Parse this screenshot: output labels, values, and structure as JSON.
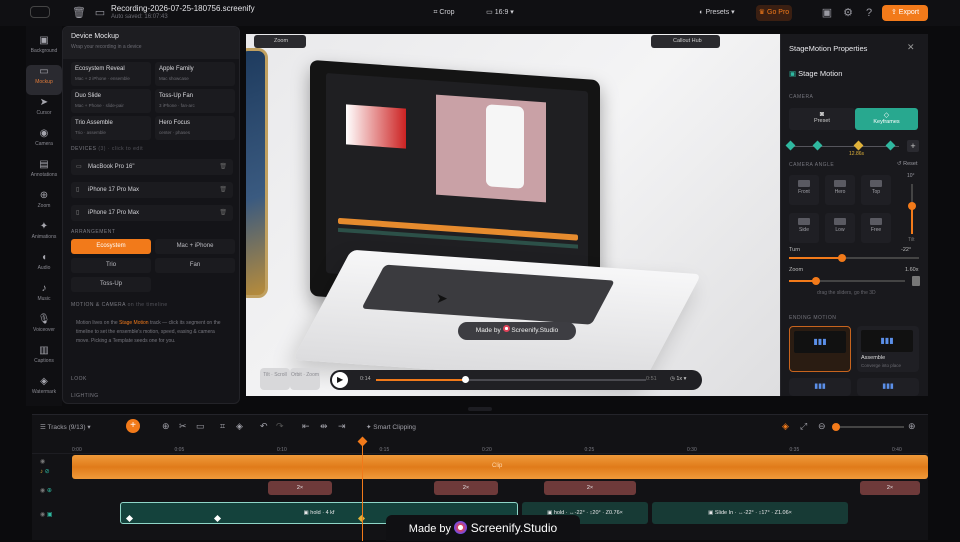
{
  "topbar": {
    "title": "Recording-2026-07-25-180756.screenify",
    "autosave": "Auto saved: 16:07:43",
    "crop": "Crop",
    "ratio": "16:9",
    "presets": "Presets",
    "gopro": "Go Pro",
    "export": "Export"
  },
  "rail": [
    {
      "label": "Background",
      "icon": "▣"
    },
    {
      "label": "Mockup",
      "icon": "▭"
    },
    {
      "label": "Cursor",
      "icon": "➤"
    },
    {
      "label": "Camera",
      "icon": "◉"
    },
    {
      "label": "Annotations",
      "icon": "▤"
    },
    {
      "label": "Zoom",
      "icon": "⊕"
    },
    {
      "label": "Animations",
      "icon": "✦"
    },
    {
      "label": "Audio",
      "icon": "◖"
    },
    {
      "label": "Music",
      "icon": "♪"
    },
    {
      "label": "Voiceover",
      "icon": "🎙"
    },
    {
      "label": "Captions",
      "icon": "▥"
    },
    {
      "label": "Watermark",
      "icon": "◈"
    }
  ],
  "mockup": {
    "title": "Device Mockup",
    "subtitle": "Wrap your recording in a device",
    "cards": [
      {
        "name": "Ecosystem Reveal",
        "desc": "Mac + 2 iPhone · ensemble"
      },
      {
        "name": "Apple Family",
        "desc": "Mac showcase"
      },
      {
        "name": "Duo Slide",
        "desc": "Mac + Phone · slide-pair"
      },
      {
        "name": "Toss-Up Fan",
        "desc": "3 iPhone · fan-arc"
      },
      {
        "name": "Trio Assemble",
        "desc": "Trio · assemble"
      },
      {
        "name": "Hero Focus",
        "desc": "center · phases"
      }
    ],
    "devices_label": "DEVICES",
    "devices_hint": "(3) · click to edit",
    "devices": [
      "MacBook Pro 16\"",
      "iPhone 17 Pro Max",
      "iPhone 17 Pro Max"
    ],
    "arrangement_label": "ARRANGEMENT",
    "arrangements": [
      "Ecosystem",
      "Mac + iPhone",
      "Trio",
      "Fan",
      "Toss-Up"
    ],
    "motion_label": "MOTION & CAMERA",
    "motion_hint": "on the timeline",
    "motion_text_1": "Motion lives on the",
    "motion_link": "Stage Motion",
    "motion_text_2": "track — click its segment on the timeline to set the ensemble's motion, speed, easing & camera move. Picking a Template seeds one for you.",
    "look_label": "LOOK",
    "lighting_label": "LIGHTING"
  },
  "canvas": {
    "chip_zoom": "Zoom",
    "chip_callout": "Callout Hub",
    "made_by": "Made by",
    "brand": "Screenify.Studio",
    "ctrl_1": "Tilt · Scroll",
    "ctrl_2": "Orbit · Zoom",
    "time_cur": "0:14",
    "time_end": "0:51",
    "speed": "1x"
  },
  "props": {
    "title": "StageMotion Properties",
    "section": "Stage Motion",
    "camera_label": "CAMERA",
    "tab_preset": "Preset",
    "tab_keyframes": "Keyframes",
    "kf_time": "12.86s",
    "angle_label": "CAMERA ANGLE",
    "reset": "Reset",
    "angles": [
      "Front",
      "Hero",
      "Top",
      "Side",
      "Low",
      "Free"
    ],
    "tilt_top": "10°",
    "tilt_bot": "Tilt",
    "turn_label": "Turn",
    "turn_val": "-22°",
    "turn_pct": 0.41,
    "zoom_label": "Zoom",
    "zoom_val": "1.60x",
    "zoom_pct": 0.23,
    "drag_hint": "drag the sliders, go the 3D",
    "ending_label": "ENDING MOTION",
    "ending_cards": [
      {
        "name": "",
        "desc": ""
      },
      {
        "name": "Assemble",
        "desc": "Converge into place"
      }
    ]
  },
  "timeline": {
    "tracks_label": "Tracks (9/13)",
    "smart_clipping": "Smart Clipping",
    "ticks": [
      "0:00",
      "0:05",
      "0:10",
      "0:15",
      "0:20",
      "0:25",
      "0:30",
      "0:35",
      "0:40"
    ],
    "audio_label": "Clip",
    "zoom_clips": [
      "2×",
      "2×",
      "2×",
      "2×"
    ],
    "motion_clips": [
      "hold · 4 kf",
      "hold · ↔-22° · ↕20° · Z0.76×",
      "Slide In · ↔-22° · ↕17° · Z1.06×"
    ],
    "watermark_made_by": "Made by",
    "watermark_brand": "Screenify.Studio"
  },
  "colors": {
    "accent": "#f27a1a",
    "teal": "#2fb8a0",
    "teal_clip": "#14423c",
    "bg": "#0b0b0d"
  }
}
